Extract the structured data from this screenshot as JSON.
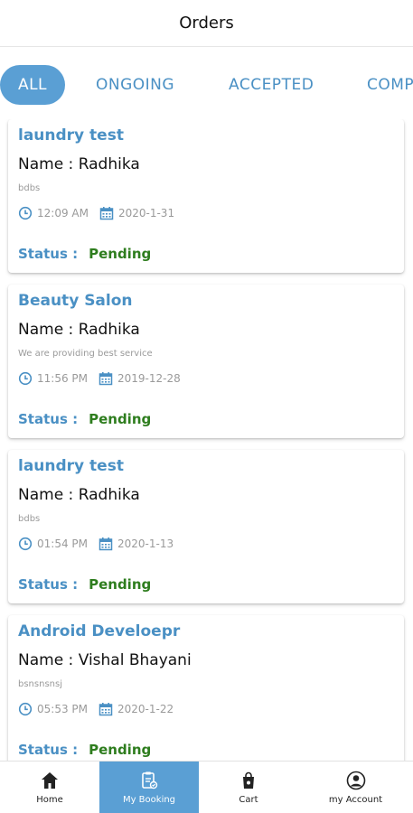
{
  "header": {
    "title": "Orders"
  },
  "tabs": [
    {
      "label": "ALL",
      "active": true
    },
    {
      "label": "ONGOING",
      "active": false
    },
    {
      "label": "ACCEPTED",
      "active": false
    },
    {
      "label": "COMPLETED",
      "active": false
    }
  ],
  "orders": [
    {
      "title": "laundry test",
      "name": "Name : Radhika",
      "description": "bdbs",
      "time": "12:09 AM",
      "date": "2020-1-31",
      "status_label": "Status :",
      "status": "Pending"
    },
    {
      "title": "Beauty Salon",
      "name": "Name : Radhika",
      "description": "We are providing best service",
      "time": "11:56 PM",
      "date": "2019-12-28",
      "status_label": "Status :",
      "status": "Pending"
    },
    {
      "title": "laundry test",
      "name": "Name : Radhika",
      "description": "bdbs",
      "time": "01:54 PM",
      "date": "2020-1-13",
      "status_label": "Status :",
      "status": "Pending"
    },
    {
      "title": "Android Develoepr",
      "name": "Name : Vishal Bhayani",
      "description": "bsnsnsnsj",
      "time": "05:53 PM",
      "date": "2020-1-22",
      "status_label": "Status :",
      "status": "Pending"
    }
  ],
  "bottom_nav": [
    {
      "label": "Home",
      "icon": "home-icon",
      "active": false
    },
    {
      "label": "My Booking",
      "icon": "booking-icon",
      "active": true
    },
    {
      "label": "Cart",
      "icon": "cart-icon",
      "active": false
    },
    {
      "label": "my Account",
      "icon": "account-icon",
      "active": false
    }
  ],
  "colors": {
    "accent": "#5a9fd4",
    "title_blue": "#4a90c4",
    "status_green": "#2e7d1e"
  }
}
